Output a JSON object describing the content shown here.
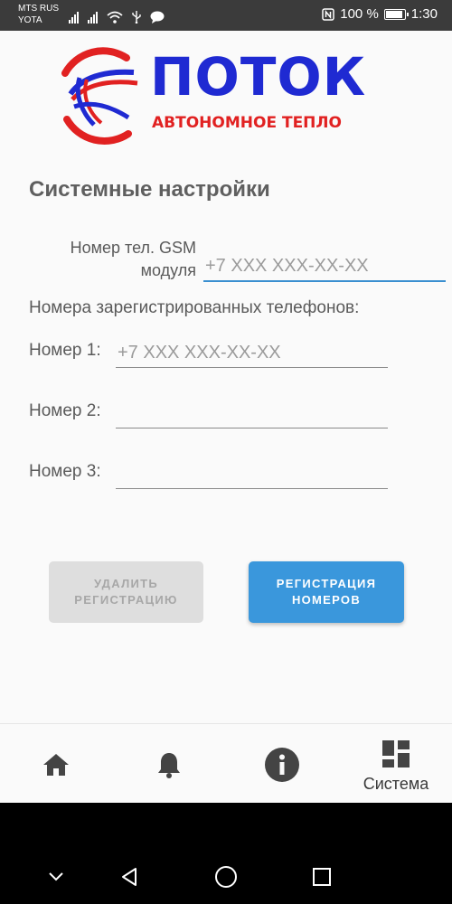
{
  "status_bar": {
    "carrier_1": "MTS RUS",
    "carrier_2": "YOTA",
    "battery_text": "100 %",
    "battery_level": 1.0,
    "time": "1:30",
    "icons": [
      "signal-icon",
      "signal-icon",
      "wifi-icon",
      "usb-icon",
      "message-icon",
      "nfc-icon",
      "battery-icon"
    ]
  },
  "logo": {
    "name": "ПОТОК",
    "subtitle": "АВТОНОМНОЕ ТЕПЛО",
    "colors": {
      "blue": "#1f2ad2",
      "red": "#e12121"
    }
  },
  "page": {
    "title": "Системные настройки"
  },
  "gsm": {
    "label": "Номер тел. GSM\nмодуля",
    "placeholder": "+7 XXX XXX-XX-XX",
    "value": ""
  },
  "registered": {
    "label": "Номера зарегистрированных телефонов:",
    "numbers": [
      {
        "label": "Номер 1:",
        "placeholder": "+7 XXX XXX-XX-XX",
        "value": ""
      },
      {
        "label": "Номер 2:",
        "placeholder": "",
        "value": ""
      },
      {
        "label": "Номер 3:",
        "placeholder": "",
        "value": ""
      }
    ]
  },
  "buttons": {
    "delete": "УДАЛИТЬ\nРЕГИСТРАЦИЮ",
    "register": "РЕГИСТРАЦИЯ\nНОМЕРОВ"
  },
  "bottom_nav": {
    "items": [
      {
        "icon": "home-icon",
        "label": ""
      },
      {
        "icon": "bell-icon",
        "label": ""
      },
      {
        "icon": "info-icon",
        "label": ""
      },
      {
        "icon": "dashboard-icon",
        "label": "Система",
        "active": true
      }
    ]
  },
  "system_nav": {
    "icons": [
      "chevron-down-icon",
      "back-icon",
      "home-circle-icon",
      "recents-icon"
    ]
  },
  "colors": {
    "accent": "#3a97dc",
    "disabled_button": "#dedede",
    "status_bar": "#3b3b3b"
  }
}
